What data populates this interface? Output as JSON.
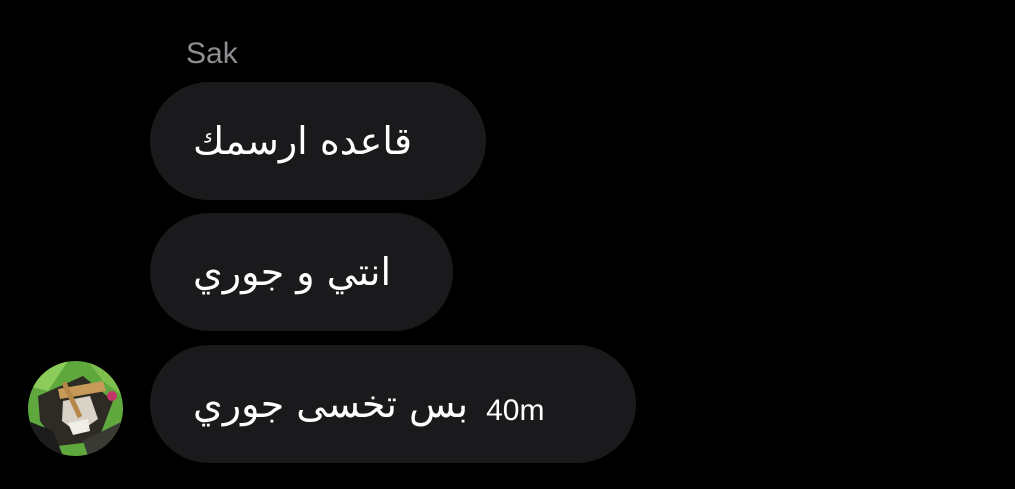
{
  "chat": {
    "sender_name": "Sak",
    "messages": [
      {
        "text": "قاعده ارسمك"
      },
      {
        "text": "انتي و جوري"
      },
      {
        "text": "بس تخسى جوري",
        "timestamp": "40m"
      }
    ],
    "avatar": {
      "icon": "profile-picture"
    }
  },
  "colors": {
    "background": "#000000",
    "bubble": "#1a1a1c",
    "sender_name": "#8d8d92",
    "text": "#ffffff"
  }
}
